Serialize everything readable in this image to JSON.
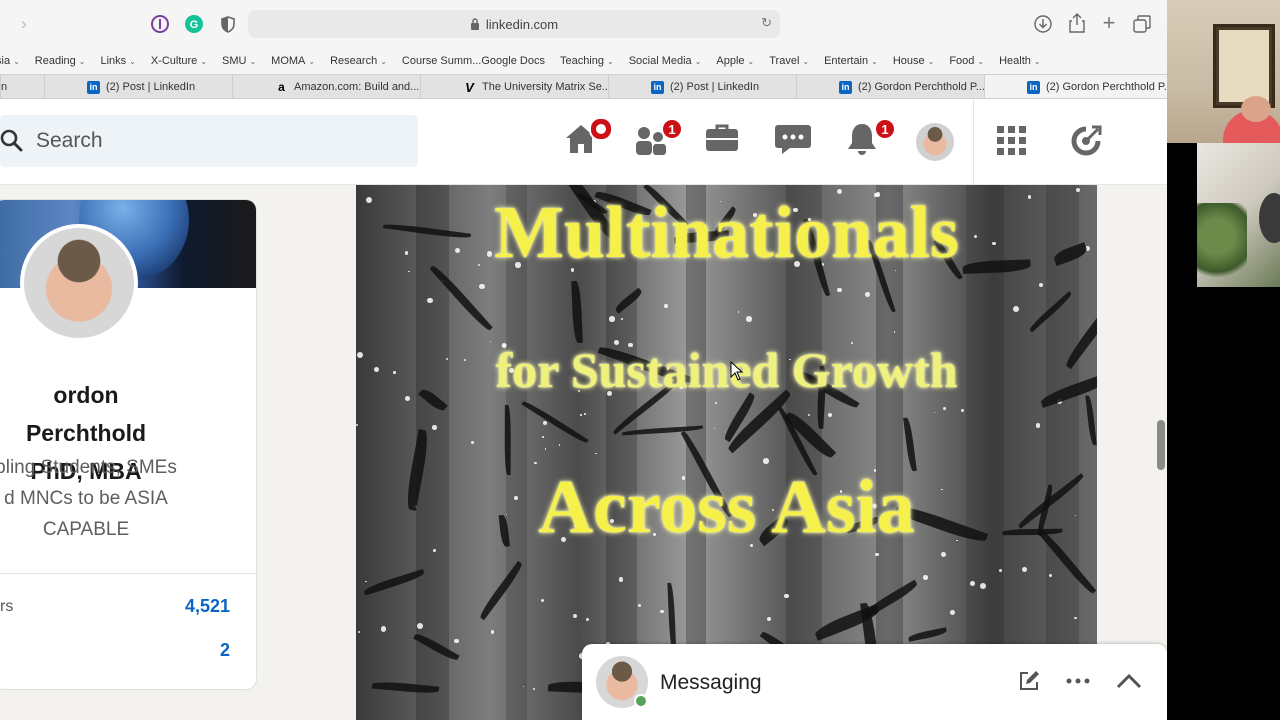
{
  "browser": {
    "url": "linkedin.com",
    "bookmarks": [
      "sia",
      "Reading",
      "Links",
      "X-Culture",
      "SMU",
      "MOMA",
      "Research",
      "Course Summ...Google Docs",
      "Teaching",
      "Social Media",
      "Apple",
      "Travel",
      "Entertain",
      "House",
      "Food",
      "Health"
    ],
    "tabs": [
      {
        "label": "n",
        "favicon": "none"
      },
      {
        "label": "(2) Post | LinkedIn",
        "favicon": "linkedin-icon"
      },
      {
        "label": "Amazon.com: Build and...",
        "favicon": "amazon-icon"
      },
      {
        "label": "The University Matrix Se...",
        "favicon": "v-icon"
      },
      {
        "label": "(2) Post | LinkedIn",
        "favicon": "linkedin-icon"
      },
      {
        "label": "(2) Gordon Perchthold P...",
        "favicon": "linkedin-icon"
      },
      {
        "label": "(2) Gordon Perchthold P...",
        "favicon": "linkedin-icon"
      }
    ]
  },
  "nav": {
    "search_placeholder": "Search",
    "badges": {
      "home": "",
      "network": "1",
      "notifications": "1"
    }
  },
  "profile": {
    "name_line1": "ordon Perchthold",
    "name_line2": "PhD, MBA",
    "desc_line1": "bling Students, SMEs",
    "desc_line2": "d MNCs to be ASIA",
    "desc_line3": "CAPABLE",
    "stat1_label": "rs",
    "stat1_value": "4,521",
    "stat2_value": "2"
  },
  "post_image": {
    "line1": "Multinationals",
    "line2": "for Sustained Growth",
    "line3": "Across Asia"
  },
  "messaging": {
    "title": "Messaging"
  },
  "colors": {
    "linkedin_blue": "#0a66c2",
    "badge_red": "#cc1016",
    "text_yellow": "#f5f04a"
  }
}
